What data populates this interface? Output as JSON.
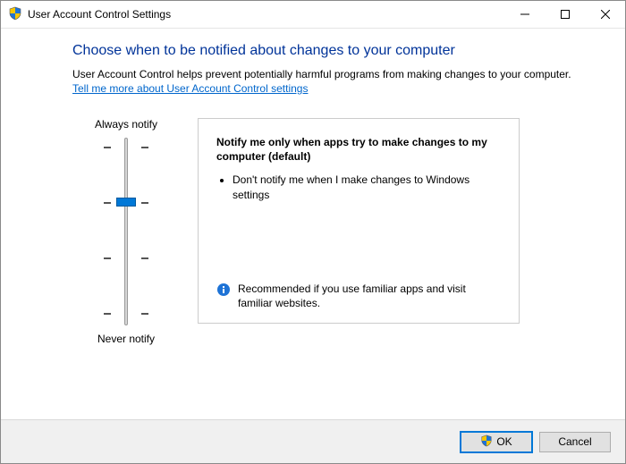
{
  "titlebar": {
    "title": "User Account Control Settings"
  },
  "content": {
    "heading": "Choose when to be notified about changes to your computer",
    "description": "User Account Control helps prevent potentially harmful programs from making changes to your computer.",
    "link": "Tell me more about User Account Control settings"
  },
  "slider": {
    "top_label": "Always notify",
    "bottom_label": "Never notify"
  },
  "panel": {
    "level_title": "Notify me only when apps try to make changes to my computer (default)",
    "bullet1": "Don't notify me when I make changes to Windows settings",
    "recommendation": "Recommended if you use familiar apps and visit familiar websites."
  },
  "footer": {
    "ok": "OK",
    "cancel": "Cancel"
  }
}
